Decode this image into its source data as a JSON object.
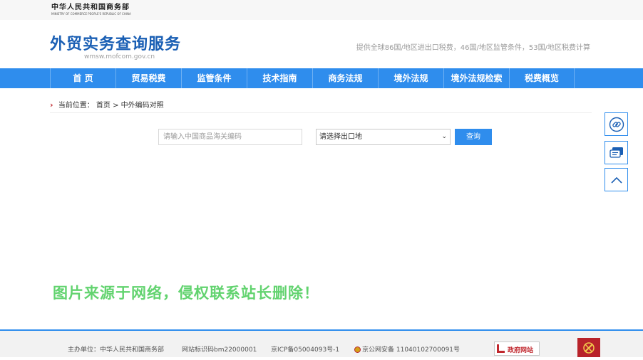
{
  "ministry": {
    "name_cn": "中华人民共和国商务部",
    "name_en": "MINISTRY OF COMMERCE PEOPLE'S REPUBLIC OF CHINA"
  },
  "site": {
    "title": "外贸实务查询服务",
    "url": "wmsw.mofcom.gov.cn",
    "info": "提供全球86国/地区进出口税费，46国/地区监管条件，53国/地区税费计算"
  },
  "nav": {
    "items": [
      "首 页",
      "贸易税费",
      "监管条件",
      "技术指南",
      "商务法规",
      "境外法规",
      "境外法规检索",
      "税费概览"
    ]
  },
  "breadcrumb": {
    "prefix": "当前位置：",
    "home": "首页",
    "separator": " > ",
    "current": "中外编码对照"
  },
  "search": {
    "input_placeholder": "请输入中国商品海关编码",
    "input_value": "",
    "select_value": "请选择出口地",
    "button_label": "查询"
  },
  "side_tools": {
    "icons": [
      "link-icon",
      "message-icon",
      "back-to-top-icon"
    ]
  },
  "watermark": {
    "text": "图片来源于网络，侵权联系站长删除！"
  },
  "footer": {
    "sponsor": "主办单位：中华人民共和国商务部",
    "site_code": "网站标识码bm22000001",
    "icp": "京ICP备05004093号-1",
    "police": "京公网安备 11040102700091号",
    "gov_logo_text": "政府网站"
  },
  "colors": {
    "brand_blue": "#2f8ded",
    "title_blue": "#1a5fb4",
    "accent_red": "#c0272d",
    "watermark_green": "#62d36f"
  }
}
